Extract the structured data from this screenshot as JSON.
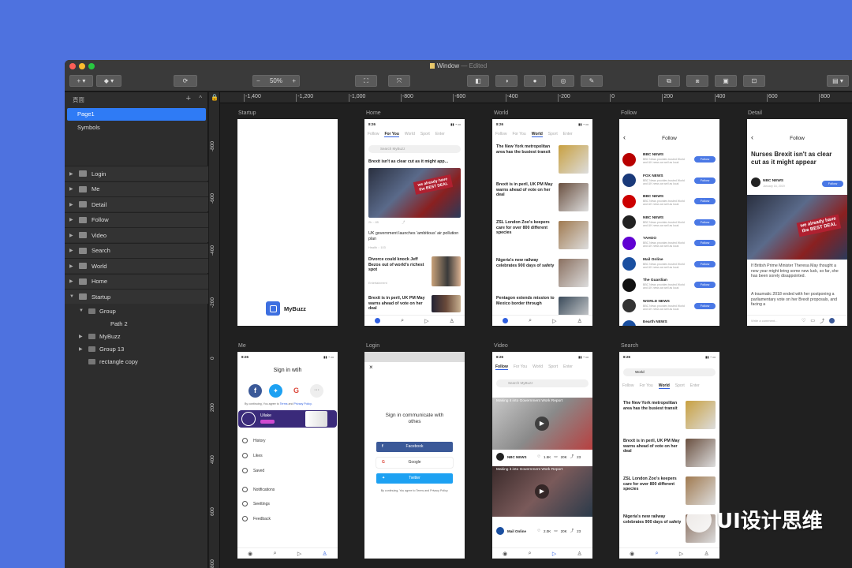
{
  "window": {
    "title": "Window",
    "status": "— Edited",
    "lights": [
      "#fe5f57",
      "#febc2e",
      "#28c840"
    ]
  },
  "toolbar": {
    "insert_icon": "plus-icon",
    "layer_icon": "layers-icon",
    "zoom_minus": "−",
    "zoom": "50%",
    "zoom_plus": "+"
  },
  "sidebar": {
    "header": "頁面",
    "add": "+",
    "collapse": "^",
    "pages": [
      "Page1",
      "Symbols"
    ],
    "artboards": [
      "Login",
      "Me",
      "Detail",
      "Follow",
      "Video",
      "Search",
      "World",
      "Home",
      "Startup"
    ],
    "startup_children": [
      {
        "label": "Group",
        "arrow": "▼",
        "indent": 1
      },
      {
        "label": "Path 2",
        "arrow": "",
        "indent": 2
      },
      {
        "label": "MyBuzz",
        "arrow": "▶",
        "indent": 1
      },
      {
        "label": "Group 13",
        "arrow": "▶",
        "indent": 1
      },
      {
        "label": "rectangle copy",
        "arrow": "",
        "indent": 1
      }
    ]
  },
  "ruler": {
    "h": [
      "-1,400",
      "-1,200",
      "-1,000",
      "-800",
      "-600",
      "-400",
      "-200",
      "0",
      "200",
      "400",
      "600",
      "800"
    ],
    "v": [
      "-800",
      "-600",
      "-400",
      "-200",
      "0",
      "200",
      "400",
      "600",
      "800"
    ]
  },
  "labels": {
    "startup": "Startup",
    "home": "Home",
    "world": "World",
    "follow": "Follow",
    "detail": "Detail",
    "me": "Me",
    "login": "Login",
    "video": "Video",
    "search": "Search"
  },
  "status": {
    "time": "8:26"
  },
  "tabs": {
    "home": [
      "Follow",
      "For You",
      "World",
      "Sport",
      "Enter"
    ],
    "search": [
      "Follow",
      "For You",
      "World",
      "Sport",
      "Enter"
    ]
  },
  "startup": {
    "name": "MyBuzz"
  },
  "home": {
    "search": "Search MyBuzz",
    "headline": "Brexit isn't as clear cut as it might app...",
    "hero_sign": "we already have the BEST DEAL",
    "item1": "UK government launches 'ambitious' air pollution plan",
    "item2": "Divorce could knock Jeff Bezos out of world's richest spot",
    "item2_meta": "Entertainment",
    "item3": "Brexit is in peril, UK PM May warns ahead of vote on her deal"
  },
  "world": {
    "items": [
      {
        "title": "The New York metropolitan area has the busiest transit"
      },
      {
        "title": "Brexit is in peril, UK PM May warns ahead of vote on her deal"
      },
      {
        "title": "ZSL London Zoo's keepers care for over 800 different species"
      },
      {
        "title": "Nigeria's new railway celebrates 900 days of safety"
      },
      {
        "title": "Pentagon extends mission to Mexico border through"
      }
    ]
  },
  "follow": {
    "title": "Follow",
    "btn": "Follow",
    "items": [
      {
        "name": "BBC NEWS",
        "color": "#b80000"
      },
      {
        "name": "FOX NEWS",
        "color": "#1a3a7a"
      },
      {
        "name": "BBC NEWS",
        "color": "#cc0000"
      },
      {
        "name": "NBC NEWS",
        "color": "#222"
      },
      {
        "name": "YAHOO",
        "color": "#6001d2"
      },
      {
        "name": "Mail Online",
        "color": "#1a4fa0"
      },
      {
        "name": "The Guardian",
        "color": "#111"
      },
      {
        "name": "WORLD NEWS",
        "color": "#333"
      },
      {
        "name": "Eearth NEWS",
        "color": "#1a4fa0"
      }
    ],
    "desc": "BBC News provides trusted World and UK news as well as local"
  },
  "detail": {
    "nav": "Follow",
    "title": "Nurses Brexit isn't as clear cut as it might appear",
    "source": "NBC NEWS",
    "date": "January 16, 2019",
    "follow": "Follow",
    "hero_sign": "we already have the BEST DEAL",
    "p1": "If British Prime Minister Theresa May thought a new year might bring some new luck, so far, she has been sorely disappointed.",
    "p2": "A traumatic 2018 ended with her postponing a parliamentary vote on her Brexit proposals, and facing a",
    "comment": "Write a comment..."
  },
  "me": {
    "title": "Sign in wtih",
    "agree": "By continuing, You agree to",
    "terms": "Terms",
    "and": "and",
    "privacy": "Privacy Policy.",
    "banner": "Uilake",
    "menu": [
      "History",
      "Likes",
      "Saved",
      "Notifications",
      "Seettings",
      "Feedback"
    ]
  },
  "login": {
    "title": "Sign in communicate with othes",
    "facebook": "Facebook",
    "google": "Google",
    "twitter": "Twitter",
    "agree": "By continuing, You agree to Terms and Privacy Policy."
  },
  "video": {
    "search": "Search MyBuzz",
    "v1": "Making it into Government Work Report",
    "v2": "Making it into Government Work Report",
    "src1": "NBC NEWS",
    "likes1": "1.5K",
    "comments1": "20K",
    "shares1": "23",
    "src2": "Mail Online",
    "likes2": "2.0K",
    "comments2": "20K",
    "shares2": "23"
  },
  "search": {
    "query": "World",
    "items": [
      {
        "title": "The New York metropolitan area has the busiest transit"
      },
      {
        "title": "Brexit is in peril, UK PM May warns ahead of vote on her deal"
      },
      {
        "title": "ZSL London Zoo's keepers care for over 800 different species"
      },
      {
        "title": "Nigeria's new railway celebrates 900 days of safety"
      }
    ]
  },
  "watermark": "UI设计思维"
}
